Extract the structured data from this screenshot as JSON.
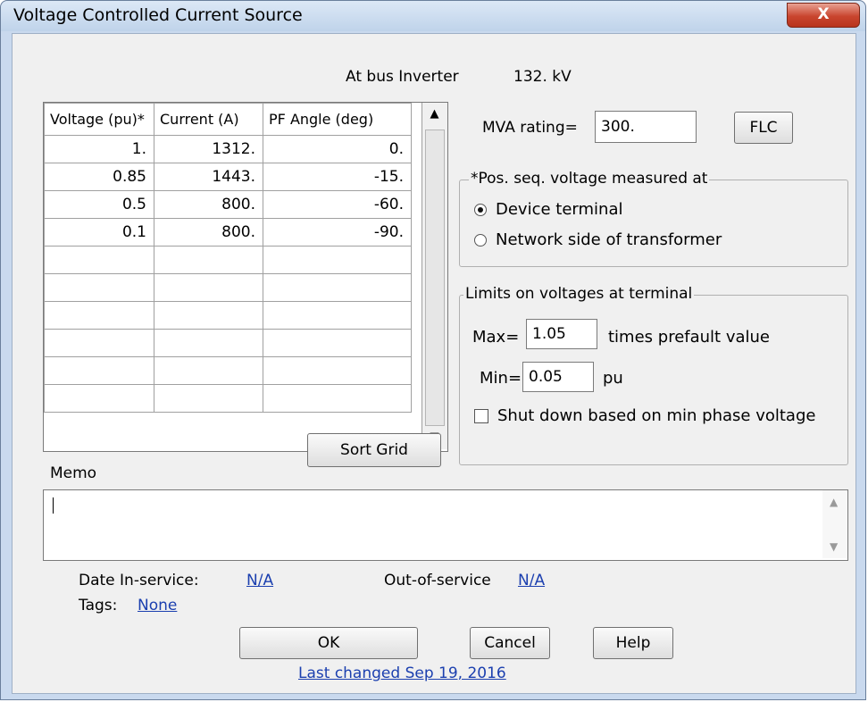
{
  "window": {
    "title": "Voltage Controlled Current Source",
    "close_label": "X"
  },
  "bus": {
    "label": "At bus Inverter",
    "kv": "132. kV"
  },
  "grid": {
    "headers": [
      "Voltage (pu)*",
      "Current (A)",
      "PF Angle (deg)"
    ],
    "rows": [
      [
        "1.",
        "1312.",
        "0."
      ],
      [
        "0.85",
        "1443.",
        "-15."
      ],
      [
        "0.5",
        "800.",
        "-60."
      ],
      [
        "0.1",
        "800.",
        "-90."
      ],
      [
        "",
        "",
        ""
      ],
      [
        "",
        "",
        ""
      ],
      [
        "",
        "",
        ""
      ],
      [
        "",
        "",
        ""
      ],
      [
        "",
        "",
        ""
      ],
      [
        "",
        "",
        ""
      ]
    ],
    "sort_button": "Sort Grid"
  },
  "mva": {
    "label": "MVA rating=",
    "value": "300.",
    "flc_button": "FLC"
  },
  "pos_seq": {
    "legend": "*Pos. seq. voltage measured at",
    "options": [
      "Device terminal",
      "Network side of transformer"
    ],
    "selected": "Device terminal"
  },
  "limits": {
    "legend": "Limits on voltages at terminal",
    "max_label": "Max=",
    "max_value": "1.05",
    "max_unit": "times prefault value",
    "min_label": "Min=",
    "min_value": "0.05",
    "min_unit": "pu",
    "shutdown_label": "Shut down based on min phase voltage",
    "shutdown_checked": false
  },
  "memo": {
    "label": "Memo",
    "value": ""
  },
  "dates": {
    "in_service_label": "Date In-service:",
    "in_service_value": "N/A",
    "out_service_label": "Out-of-service",
    "out_service_value": "N/A",
    "tags_label": "Tags:",
    "tags_value": "None"
  },
  "buttons": {
    "ok": "OK",
    "cancel": "Cancel",
    "help": "Help"
  },
  "footer": {
    "last_changed": "Last changed Sep 19, 2016"
  }
}
